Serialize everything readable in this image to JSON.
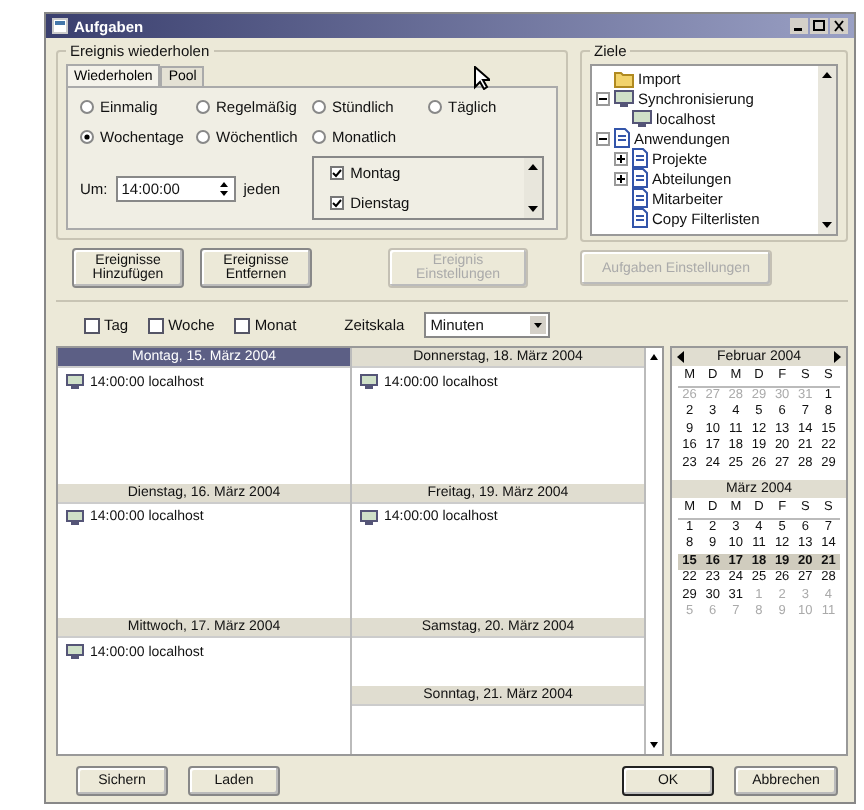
{
  "window": {
    "title": "Aufgaben"
  },
  "repeat_group": {
    "title": "Ereignis wiederholen",
    "tabs": [
      {
        "label": "Wiederholen",
        "selected": true
      },
      {
        "label": "Pool",
        "selected": false
      }
    ],
    "options": [
      {
        "label": "Einmalig",
        "selected": false
      },
      {
        "label": "Regelmäßig",
        "selected": false
      },
      {
        "label": "Stündlich",
        "selected": false
      },
      {
        "label": "Täglich",
        "selected": false
      },
      {
        "label": "Wochentage",
        "selected": true
      },
      {
        "label": "Wöchentlich",
        "selected": false
      },
      {
        "label": "Monatlich",
        "selected": false
      }
    ],
    "time": {
      "label": "Um:",
      "value": "14:00:00",
      "suffix": "jeden"
    },
    "days": [
      {
        "label": "Montag",
        "checked": true
      },
      {
        "label": "Dienstag",
        "checked": true
      }
    ]
  },
  "targets": {
    "title": "Ziele",
    "tree": [
      {
        "label": "Import",
        "kind": "folder"
      },
      {
        "label": "Synchronisierung",
        "kind": "server",
        "expanded": true,
        "children": [
          {
            "label": "localhost",
            "kind": "server"
          }
        ]
      },
      {
        "label": "Anwendungen",
        "kind": "document",
        "expanded": true,
        "children": [
          {
            "label": "Projekte",
            "kind": "document",
            "expanded": false
          },
          {
            "label": "Abteilungen",
            "kind": "document",
            "expanded": false
          },
          {
            "label": "Mitarbeiter",
            "kind": "document"
          },
          {
            "label": "Copy Filterlisten",
            "kind": "document"
          }
        ]
      }
    ],
    "button": {
      "label": "Aufgaben Einstellungen",
      "disabled": true
    }
  },
  "actions": [
    {
      "label": "Ereignisse Hinzufügen",
      "disabled": false
    },
    {
      "label": "Ereignisse Entfernen",
      "disabled": false
    },
    {
      "label": "Ereignis Einstellungen",
      "disabled": true
    }
  ],
  "view_options": {
    "checkboxes": [
      {
        "label": "Tag",
        "checked": false
      },
      {
        "label": "Woche",
        "checked": false
      },
      {
        "label": "Monat",
        "checked": false
      }
    ],
    "timescale": {
      "label": "Zeitskala",
      "value": "Minuten"
    }
  },
  "week": {
    "left_column": [
      {
        "title": "Montag, 15. März 2004",
        "selected": true,
        "entries": [
          "14:00:00 localhost"
        ]
      },
      {
        "title": "Dienstag, 16. März 2004",
        "selected": false,
        "entries": [
          "14:00:00 localhost"
        ]
      },
      {
        "title": "Mittwoch, 17. März 2004",
        "selected": false,
        "entries": [
          "14:00:00 localhost"
        ]
      }
    ],
    "right_column": [
      {
        "title": "Donnerstag, 18. März 2004",
        "selected": false,
        "entries": [
          "14:00:00 localhost"
        ]
      },
      {
        "title": "Freitag, 19. März 2004",
        "selected": false,
        "entries": [
          "14:00:00 localhost"
        ]
      },
      {
        "title": "Samstag, 20. März 2004",
        "selected": false
      },
      {
        "title": "Sonntag, 21. März 2004",
        "selected": false
      }
    ]
  },
  "calendar": [
    {
      "title": "Februar 2004",
      "weekdays": [
        "M",
        "D",
        "M",
        "D",
        "F",
        "S",
        "S"
      ],
      "days": [
        {
          "day": "26",
          "other_month": true,
          "selected": false
        },
        {
          "day": "27",
          "other_month": true,
          "selected": false
        },
        {
          "day": "28",
          "other_month": true,
          "selected": false
        },
        {
          "day": "29",
          "other_month": true,
          "selected": false
        },
        {
          "day": "30",
          "other_month": true,
          "selected": false
        },
        {
          "day": "31",
          "other_month": true,
          "selected": false
        },
        {
          "day": "1",
          "other_month": false,
          "selected": false
        },
        {
          "day": "2",
          "other_month": false,
          "selected": false
        },
        {
          "day": "3",
          "other_month": false,
          "selected": false
        },
        {
          "day": "4",
          "other_month": false,
          "selected": false
        },
        {
          "day": "5",
          "other_month": false,
          "selected": false
        },
        {
          "day": "6",
          "other_month": false,
          "selected": false
        },
        {
          "day": "7",
          "other_month": false,
          "selected": false
        },
        {
          "day": "8",
          "other_month": false,
          "selected": false
        },
        {
          "day": "9",
          "other_month": false,
          "selected": false
        },
        {
          "day": "10",
          "other_month": false,
          "selected": false
        },
        {
          "day": "11",
          "other_month": false,
          "selected": false
        },
        {
          "day": "12",
          "other_month": false,
          "selected": false
        },
        {
          "day": "13",
          "other_month": false,
          "selected": false
        },
        {
          "day": "14",
          "other_month": false,
          "selected": false
        },
        {
          "day": "15",
          "other_month": false,
          "selected": false
        },
        {
          "day": "16",
          "other_month": false,
          "selected": false
        },
        {
          "day": "17",
          "other_month": false,
          "selected": false
        },
        {
          "day": "18",
          "other_month": false,
          "selected": false
        },
        {
          "day": "19",
          "other_month": false,
          "selected": false
        },
        {
          "day": "20",
          "other_month": false,
          "selected": false
        },
        {
          "day": "21",
          "other_month": false,
          "selected": false
        },
        {
          "day": "22",
          "other_month": false,
          "selected": false
        },
        {
          "day": "23",
          "other_month": false,
          "selected": false
        },
        {
          "day": "24",
          "other_month": false,
          "selected": false
        },
        {
          "day": "25",
          "other_month": false,
          "selected": false
        },
        {
          "day": "26",
          "other_month": false,
          "selected": false
        },
        {
          "day": "27",
          "other_month": false,
          "selected": false
        },
        {
          "day": "28",
          "other_month": false,
          "selected": false
        },
        {
          "day": "29",
          "other_month": false,
          "selected": false
        }
      ]
    },
    {
      "title": "März 2004",
      "weekdays": [
        "M",
        "D",
        "M",
        "D",
        "F",
        "S",
        "S"
      ],
      "days": [
        {
          "day": "1",
          "other_month": false,
          "selected": false
        },
        {
          "day": "2",
          "other_month": false,
          "selected": false
        },
        {
          "day": "3",
          "other_month": false,
          "selected": false
        },
        {
          "day": "4",
          "other_month": false,
          "selected": false
        },
        {
          "day": "5",
          "other_month": false,
          "selected": false
        },
        {
          "day": "6",
          "other_month": false,
          "selected": false
        },
        {
          "day": "7",
          "other_month": false,
          "selected": false
        },
        {
          "day": "8",
          "other_month": false,
          "selected": false
        },
        {
          "day": "9",
          "other_month": false,
          "selected": false
        },
        {
          "day": "10",
          "other_month": false,
          "selected": false
        },
        {
          "day": "11",
          "other_month": false,
          "selected": false
        },
        {
          "day": "12",
          "other_month": false,
          "selected": false
        },
        {
          "day": "13",
          "other_month": false,
          "selected": false
        },
        {
          "day": "14",
          "other_month": false,
          "selected": false
        },
        {
          "day": "15",
          "other_month": false,
          "selected": true
        },
        {
          "day": "16",
          "other_month": false,
          "selected": true
        },
        {
          "day": "17",
          "other_month": false,
          "selected": true
        },
        {
          "day": "18",
          "other_month": false,
          "selected": true
        },
        {
          "day": "19",
          "other_month": false,
          "selected": true
        },
        {
          "day": "20",
          "other_month": false,
          "selected": true
        },
        {
          "day": "21",
          "other_month": false,
          "selected": true
        },
        {
          "day": "22",
          "other_month": false,
          "selected": false
        },
        {
          "day": "23",
          "other_month": false,
          "selected": false
        },
        {
          "day": "24",
          "other_month": false,
          "selected": false
        },
        {
          "day": "25",
          "other_month": false,
          "selected": false
        },
        {
          "day": "26",
          "other_month": false,
          "selected": false
        },
        {
          "day": "27",
          "other_month": false,
          "selected": false
        },
        {
          "day": "28",
          "other_month": false,
          "selected": false
        },
        {
          "day": "29",
          "other_month": false,
          "selected": false
        },
        {
          "day": "30",
          "other_month": false,
          "selected": false
        },
        {
          "day": "31",
          "other_month": false,
          "selected": false
        },
        {
          "day": "1",
          "other_month": true,
          "selected": false
        },
        {
          "day": "2",
          "other_month": true,
          "selected": false
        },
        {
          "day": "3",
          "other_month": true,
          "selected": false
        },
        {
          "day": "4",
          "other_month": true,
          "selected": false
        },
        {
          "day": "5",
          "other_month": true,
          "selected": false
        },
        {
          "day": "6",
          "other_month": true,
          "selected": false
        },
        {
          "day": "7",
          "other_month": true,
          "selected": false
        },
        {
          "day": "8",
          "other_month": true,
          "selected": false
        },
        {
          "day": "9",
          "other_month": true,
          "selected": false
        },
        {
          "day": "10",
          "other_month": true,
          "selected": false
        },
        {
          "day": "11",
          "other_month": true,
          "selected": false
        }
      ]
    }
  ],
  "footer": {
    "left": [
      "Sichern",
      "Laden"
    ],
    "ok": "OK",
    "cancel": "Abbrechen"
  }
}
